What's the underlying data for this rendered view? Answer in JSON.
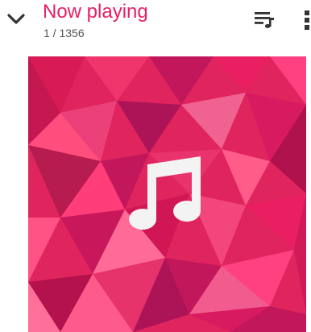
{
  "header": {
    "title": "Now playing",
    "position": "1 / 1356"
  },
  "icons": {
    "collapse": "chevron-down-icon",
    "queue": "playlist-icon",
    "more": "more-vertical-icon",
    "album_art_placeholder": "music-note-icon"
  },
  "colors": {
    "accent": "#e91e63",
    "icon": "#333333",
    "art_base": "#e0245e"
  }
}
